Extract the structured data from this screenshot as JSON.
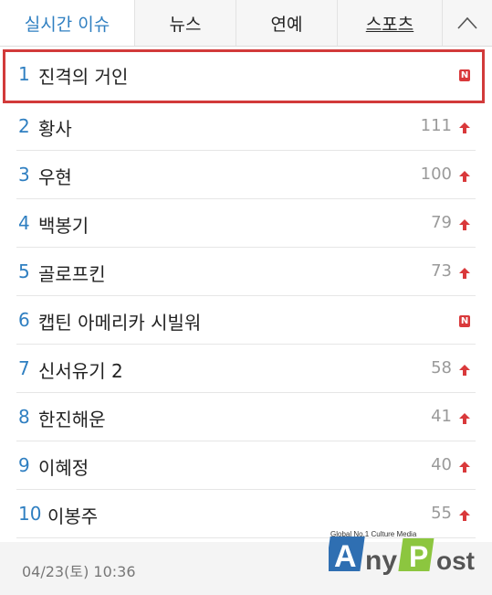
{
  "tabs": [
    {
      "label": "실시간 이슈",
      "active": true
    },
    {
      "label": "뉴스",
      "active": false
    },
    {
      "label": "연예",
      "active": false
    },
    {
      "label": "스포츠",
      "active": false
    }
  ],
  "toggle_icon": "chevron-up-icon",
  "items": [
    {
      "rank": "1",
      "keyword": "진격의 거인",
      "count": "",
      "badge": "N"
    },
    {
      "rank": "2",
      "keyword": "황사",
      "count": "111",
      "badge": ""
    },
    {
      "rank": "3",
      "keyword": "우현",
      "count": "100",
      "badge": ""
    },
    {
      "rank": "4",
      "keyword": "백봉기",
      "count": "79",
      "badge": ""
    },
    {
      "rank": "5",
      "keyword": "골로프킨",
      "count": "73",
      "badge": ""
    },
    {
      "rank": "6",
      "keyword": "캡틴 아메리카 시빌워",
      "count": "",
      "badge": "N"
    },
    {
      "rank": "7",
      "keyword": "신서유기 2",
      "count": "58",
      "badge": ""
    },
    {
      "rank": "8",
      "keyword": "한진해운",
      "count": "41",
      "badge": ""
    },
    {
      "rank": "9",
      "keyword": "이혜정",
      "count": "40",
      "badge": ""
    },
    {
      "rank": "10",
      "keyword": "이봉주",
      "count": "55",
      "badge": ""
    }
  ],
  "footer": {
    "timestamp": "04/23(토) 10:36"
  },
  "watermark": {
    "tagline": "Global No.1 Culture Media",
    "brand": "AnyPost"
  },
  "colors": {
    "accent": "#2f7fc1",
    "highlight": "#d23a3a",
    "arrow": "#d9393b"
  }
}
